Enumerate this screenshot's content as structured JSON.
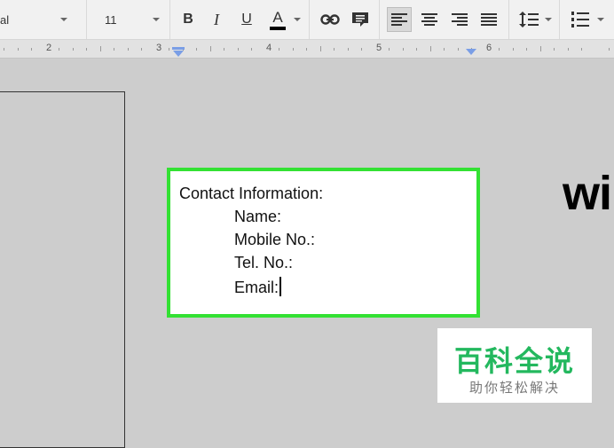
{
  "toolbar": {
    "font_name": "al",
    "font_size": "11",
    "bold_label": "B",
    "italic_label": "I",
    "underline_label": "U",
    "text_color_label": "A",
    "text_color": "#000000"
  },
  "ruler": {
    "numbers": [
      "2",
      "3",
      "4",
      "5",
      "6"
    ]
  },
  "textbox": {
    "border_color": "#33e133",
    "lines": [
      "Contact Information:",
      "Name:",
      "Mobile No.:",
      "Tel. No.:",
      "Email:"
    ]
  },
  "background_text": "wi",
  "watermark": {
    "title": "百科全说",
    "subtitle": "助你轻松解决",
    "color": "#23b85e"
  }
}
